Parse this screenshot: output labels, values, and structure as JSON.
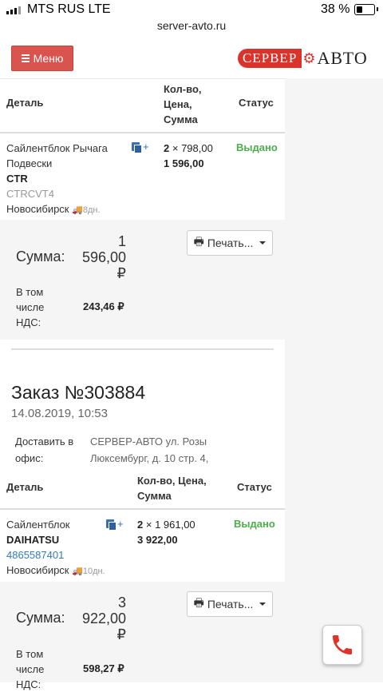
{
  "statusbar": {
    "carrier": "MTS RUS  LTE",
    "battery": "38 %"
  },
  "browser": {
    "url": "server-avto.ru"
  },
  "navbar": {
    "menu_label": "Меню",
    "logo_left": "СЕРВЕР",
    "logo_right": "АВТО"
  },
  "order1": {
    "headers": {
      "detail": "Деталь",
      "qty": "Кол-во,",
      "price": "Цена,",
      "sum": "Сумма",
      "status": "Статус"
    },
    "item": {
      "name_line1": "Сайлентблок Рычага",
      "name_line2": "Подвески",
      "brand": "CTR",
      "code": "CTRCVT4",
      "city": "Новосибирск",
      "days": "8дн.",
      "qty": "2",
      "price": "× 798,00",
      "sum": "1 596,00",
      "status": "Выдано",
      "add_label": "+"
    },
    "print_label": "Печать...",
    "total_label": "Сумма:",
    "total_line1": "1",
    "total_line2": "596,00",
    "total_line3": "₽",
    "vat_label_1": "В том",
    "vat_label_2": "числе",
    "vat_label_3": "НДС:",
    "vat_value": "243,46 ₽"
  },
  "order2": {
    "title": "Заказ №303884",
    "date": "14.08.2019, 10:53",
    "deliver_label_1": "Доставить в",
    "deliver_label_2": "офис:",
    "deliver_value_1": "СЕРВЕР-АВТО ул. Розы",
    "deliver_value_2": "Люксембург, д. 10 стр. 4,",
    "headers": {
      "detail": "Деталь",
      "qty_price": "Кол-во, Цена,",
      "sum": "Сумма",
      "status": "Статус"
    },
    "item": {
      "name": "Сайлентблок",
      "brand": "DAIHATSU",
      "code": "4865587401",
      "city": "Новосибирск",
      "days": "10дн.",
      "qty": "2",
      "price": "× 1 961,00",
      "sum": "3 922,00",
      "status": "Выдано",
      "add_label": "+"
    },
    "print_label": "Печать...",
    "total_label": "Сумма:",
    "total_line1": "3",
    "total_line2": "922,00",
    "total_line3": "₽",
    "vat_label_1": "В том",
    "vat_label_2": "числе",
    "vat_label_3": "НДС:",
    "vat_value": "598,27 ₽"
  },
  "colors": {
    "accent": "#d9534f",
    "status_green": "#4cae4c",
    "link": "#337ab7"
  },
  "icons": {
    "menu": "bars-icon",
    "print": "printer-icon",
    "truck": "truck-icon",
    "copy": "copy-icon",
    "phone": "phone-icon"
  }
}
